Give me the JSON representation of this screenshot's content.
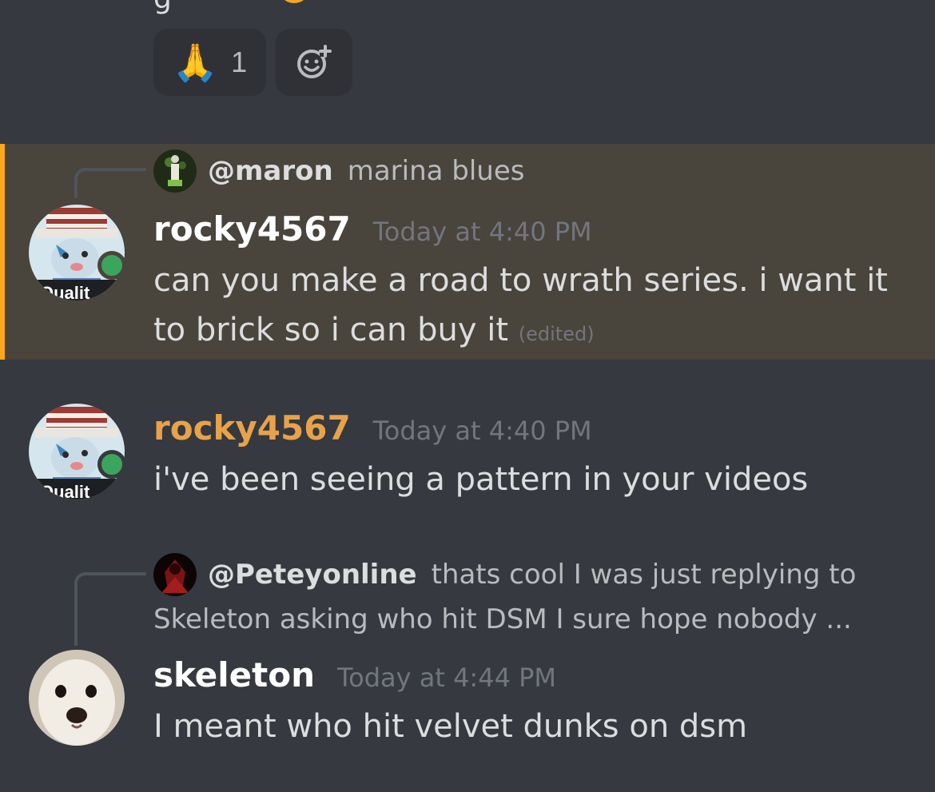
{
  "reactions": [
    {
      "emoji": "🙏",
      "count": "1"
    }
  ],
  "add_reaction_icon": "smiley-plus-icon",
  "messages": [
    {
      "reply": {
        "name": "@maron",
        "text": "marina blues",
        "avatar_icon": "broccoli-avatar"
      },
      "username": "rocky4567",
      "timestamp": "Today at 4:40 PM",
      "text_line1": "can you make a road to wrath series. i want it",
      "text_line2": "to brick so i can buy it",
      "edited": "(edited)",
      "highlighted": true
    },
    {
      "username": "rocky4567",
      "timestamp": "Today at 4:40 PM",
      "text_line1": "i've been seeing a pattern in your videos"
    },
    {
      "reply": {
        "name": "@Peteyonline",
        "text_line1": "thats cool I was just replying to",
        "text_line2": "Skeleton asking who hit DSM I sure hope nobody ...",
        "avatar_icon": "red-figure-avatar"
      },
      "username": "skeleton",
      "timestamp": "Today at 4:44 PM",
      "text_line1": "I meant who hit velvet dunks on dsm"
    }
  ],
  "colors": {
    "background": "#36393f",
    "highlight": "#49443c",
    "highlight_bar": "#faa81a",
    "online": "#3ba55d",
    "role_orange": "#e8a24a"
  }
}
